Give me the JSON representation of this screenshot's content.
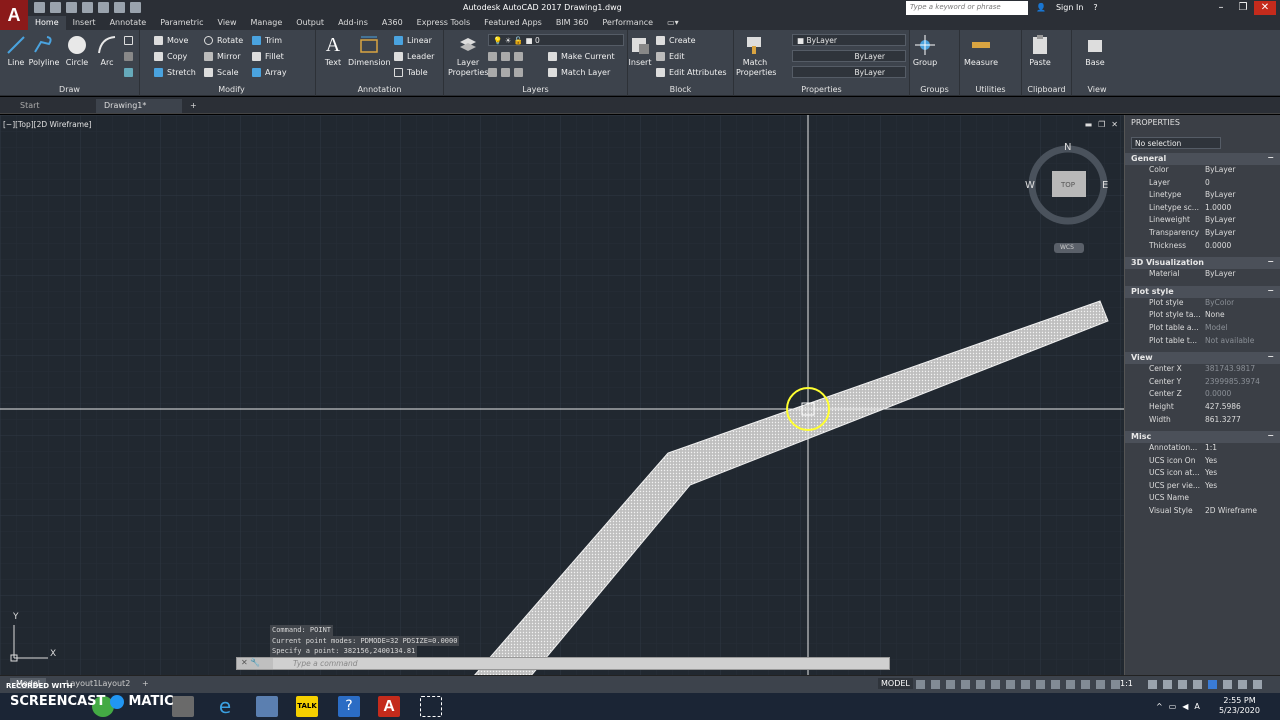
{
  "app": {
    "logo_letter": "A",
    "window_title": "Autodesk AutoCAD 2017    Drawing1.dwg",
    "search_placeholder": "Type a keyword or phrase",
    "sign_in": "Sign In"
  },
  "ribbon_tabs": [
    "Home",
    "Insert",
    "Annotate",
    "Parametric",
    "View",
    "Manage",
    "Output",
    "Add-ins",
    "A360",
    "Express Tools",
    "Featured Apps",
    "BIM 360",
    "Performance"
  ],
  "draw": {
    "label": "Draw",
    "line": "Line",
    "polyline": "Polyline",
    "circle": "Circle",
    "arc": "Arc"
  },
  "modify": {
    "label": "Modify",
    "move": "Move",
    "rotate": "Rotate",
    "trim": "Trim",
    "copy": "Copy",
    "mirror": "Mirror",
    "fillet": "Fillet",
    "stretch": "Stretch",
    "scale": "Scale",
    "array": "Array"
  },
  "annotation": {
    "label": "Annotation",
    "text": "Text",
    "dimension": "Dimension",
    "linear": "Linear",
    "leader": "Leader",
    "table": "Table"
  },
  "layers": {
    "label": "Layers",
    "layer_properties": "Layer Properties",
    "current_layer": "0",
    "make_current": "Make Current",
    "match_layer": "Match Layer"
  },
  "block": {
    "label": "Block",
    "insert": "Insert",
    "create": "Create",
    "edit": "Edit",
    "edit_attributes": "Edit Attributes"
  },
  "properties_panel": {
    "label": "Properties",
    "match_properties": "Match Properties",
    "color": "ByLayer",
    "linetype": "ByLayer",
    "lineweight": "ByLayer"
  },
  "groups": {
    "label": "Groups",
    "group": "Group"
  },
  "utilities": {
    "label": "Utilities",
    "measure": "Measure"
  },
  "clipboard": {
    "label": "Clipboard",
    "paste": "Paste"
  },
  "view_panel": {
    "label": "View",
    "base": "Base"
  },
  "file_tabs": {
    "start": "Start",
    "drawing": "Drawing1*"
  },
  "viewport": {
    "label": "[−][Top][2D Wireframe]",
    "viewcube": {
      "north": "N",
      "west": "W",
      "east": "E",
      "top": "TOP",
      "ucs": "WCS"
    },
    "ucs_y": "Y",
    "ucs_x": "X"
  },
  "command": {
    "history": [
      "Command: POINT",
      "Current point modes:  PDMODE=32  PDSIZE=0.0000",
      "Specify a point: 382156,2400134.81"
    ],
    "placeholder": "Type a command"
  },
  "properties": {
    "title": "PROPERTIES",
    "selection": "No selection",
    "sections": [
      {
        "name": "General",
        "rows": [
          [
            "Color",
            "ByLayer"
          ],
          [
            "Layer",
            "0"
          ],
          [
            "Linetype",
            "ByLayer"
          ],
          [
            "Linetype sc...",
            "1.0000"
          ],
          [
            "Lineweight",
            "ByLayer"
          ],
          [
            "Transparency",
            "ByLayer"
          ],
          [
            "Thickness",
            "0.0000"
          ]
        ]
      },
      {
        "name": "3D Visualization",
        "rows": [
          [
            "Material",
            "ByLayer"
          ]
        ]
      },
      {
        "name": "Plot style",
        "rows": [
          [
            "Plot style",
            "ByColor"
          ],
          [
            "Plot style ta...",
            "None"
          ],
          [
            "Plot table a...",
            "Model"
          ],
          [
            "Plot table t...",
            "Not available"
          ]
        ]
      },
      {
        "name": "View",
        "rows": [
          [
            "Center X",
            "381743.9817"
          ],
          [
            "Center Y",
            "2399985.3974"
          ],
          [
            "Center Z",
            "0.0000"
          ],
          [
            "Height",
            "427.5986"
          ],
          [
            "Width",
            "861.3277"
          ]
        ]
      },
      {
        "name": "Misc",
        "rows": [
          [
            "Annotation...",
            "1:1"
          ],
          [
            "UCS icon On",
            "Yes"
          ],
          [
            "UCS icon at...",
            "Yes"
          ],
          [
            "UCS per vie...",
            "Yes"
          ],
          [
            "UCS Name",
            ""
          ],
          [
            "Visual Style",
            "2D Wireframe"
          ]
        ]
      }
    ]
  },
  "status": {
    "model_tab": "Model",
    "layout1": "Layout1",
    "layout2": "Layout2",
    "model_btn": "MODEL",
    "scale": "1:1"
  },
  "watermark": {
    "line1": "RECORDED WITH",
    "line2": "SCREENCAST",
    "line3": "MATIC"
  },
  "clock": {
    "time": "2:55 PM",
    "date": "5/23/2020"
  }
}
